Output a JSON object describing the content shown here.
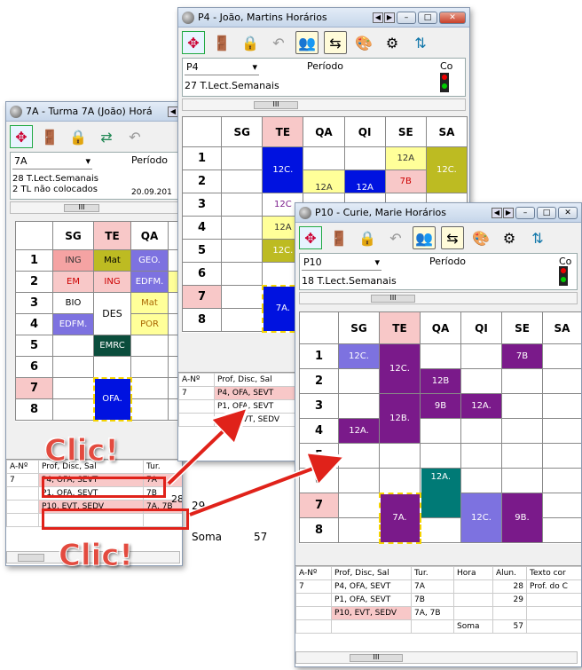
{
  "window_teacher_joao": {
    "title": "P4 - João, Martins Horários",
    "select_value": "P4",
    "periodo_label": "Período",
    "co_label": "Co",
    "summary": "27 T.Lect.Semanais",
    "scroll_thumb": "III",
    "days": [
      "SG",
      "TE",
      "QA",
      "QI",
      "SE",
      "SA"
    ],
    "periods": [
      "1",
      "2",
      "3",
      "4",
      "5",
      "6",
      "7",
      "8"
    ],
    "cells": {
      "te_block1": "12C.",
      "te_p3": "12C",
      "te_p4": "12A",
      "te_p5": "12C.",
      "te_block7": "7A.",
      "se_p1": "12A",
      "se_p2": "7B",
      "sa_block1": "12C.",
      "qa_p2": "12A",
      "qi_p2": "12A"
    },
    "list_headers": [
      "A-Nº",
      "Prof, Disc, Sal"
    ],
    "list_rows": [
      [
        "7",
        "P4, OFA, SEVT"
      ],
      [
        "",
        "P1, OFA, SEVT"
      ],
      [
        "",
        "P10, EVT, SEDV"
      ]
    ]
  },
  "window_class_7a": {
    "title": "7A - Turma 7A (João) Horá",
    "select_value": "7A",
    "periodo_label": "Período",
    "summary_1": "28 T.Lect.Semanais",
    "summary_2": "2 TL não colocados",
    "date": "20.09.201",
    "scroll_thumb": "III",
    "days": [
      "SG",
      "TE",
      "QA"
    ],
    "periods": [
      "1",
      "2",
      "3",
      "4",
      "5",
      "6",
      "7",
      "8"
    ],
    "cells": {
      "sg": [
        "ING",
        "EM",
        "BIO",
        "EDFM."
      ],
      "te": [
        "Mat",
        "ING",
        "DES",
        "EMRC",
        "OFA."
      ],
      "qa": [
        "GEO.",
        "EDFM.",
        "Mat",
        "POR"
      ]
    },
    "list_headers": [
      "A-Nº",
      "Prof, Disc, Sal",
      "Tur."
    ],
    "list_rows": [
      [
        "7",
        "P4, OFA, SEVT",
        "7A",
        "28"
      ],
      [
        "",
        "P1, OFA, SEVT",
        "7B",
        "29"
      ],
      [
        "",
        "P10, EVT, SEDV",
        "7A, 7B",
        ""
      ]
    ],
    "soma_label": "Soma",
    "soma_value": "57"
  },
  "window_teacher_curie": {
    "title": "P10 - Curie, Marie Horários",
    "select_value": "P10",
    "periodo_label": "Período",
    "co_label": "Co",
    "summary": "18 T.Lect.Semanais",
    "scroll_thumb": "III",
    "days": [
      "SG",
      "TE",
      "QA",
      "QI",
      "SE",
      "SA"
    ],
    "periods": [
      "1",
      "2",
      "3",
      "4",
      "5",
      "6",
      "7",
      "8"
    ],
    "cells": {
      "sg_p1": "12C.",
      "te_block1": "12C.",
      "se_p1": "7B",
      "qa_p2": "12B",
      "te_block3": "12B.",
      "qa_p3": "9B",
      "qi_p3": "12A.",
      "sg_p4": "12A.",
      "qa_block6": "12A.",
      "te_block7": "7A.",
      "qi_block7": "12C.",
      "se_block7": "9B."
    },
    "list_headers": [
      "A-Nº",
      "Prof, Disc, Sal",
      "Tur.",
      "Hora",
      "Alun.",
      "Texto cor"
    ],
    "list_rows": [
      [
        "7",
        "P4, OFA, SEVT",
        "7A",
        "",
        "28",
        "Prof. do C"
      ],
      [
        "",
        "P1, OFA, SEVT",
        "7B",
        "",
        "29",
        ""
      ],
      [
        "",
        "P10, EVT, SEDV",
        "7A, 7B",
        "",
        "",
        ""
      ]
    ],
    "soma_label": "Soma",
    "soma_value": "57",
    "scroll_thumb_bottom": "III"
  },
  "annotations": {
    "clic_1": "Clic!",
    "clic_2": "Clic!"
  },
  "colors": {
    "pink": "#f8c8c8",
    "blue": "#0012e0",
    "purple": "#7a1a8a",
    "olive": "#bdbb22",
    "yellow": "#ffff99",
    "teal": "#007a76",
    "lavender": "#7d72e0",
    "red": "#e0221a"
  }
}
